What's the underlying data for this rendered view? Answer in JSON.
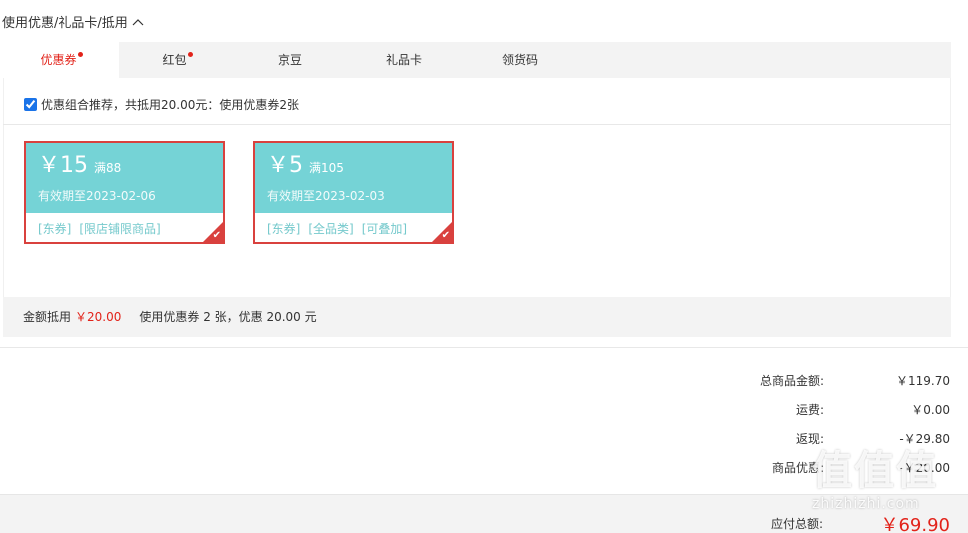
{
  "section_title": "使用优惠/礼品卡/抵用",
  "tabs": [
    {
      "label": "优惠券",
      "active": true,
      "dot": true
    },
    {
      "label": "红包",
      "active": false,
      "dot": true
    },
    {
      "label": "京豆",
      "active": false,
      "dot": false
    },
    {
      "label": "礼品卡",
      "active": false,
      "dot": false
    },
    {
      "label": "领货码",
      "active": false,
      "dot": false
    }
  ],
  "combo": {
    "checked": true,
    "text": "优惠组合推荐，共抵用20.00元：使用优惠券2张"
  },
  "coupons": [
    {
      "amount": "￥15",
      "condition": "满88",
      "valid": "有效期至2023-02-06",
      "tags": [
        "[东券]",
        "[限店铺限商品]"
      ],
      "selected": true
    },
    {
      "amount": "￥5",
      "condition": "满105",
      "valid": "有效期至2023-02-03",
      "tags": [
        "[东券]",
        "[全品类]",
        "[可叠加]"
      ],
      "selected": true
    }
  ],
  "summary": {
    "label": "金额抵用",
    "amount": "￥20.00",
    "desc": "使用优惠券 2 张，优惠 20.00 元"
  },
  "totals": [
    {
      "label": "总商品金额:",
      "value": "￥119.70"
    },
    {
      "label": "运费:",
      "value": "￥0.00"
    },
    {
      "label": "返现:",
      "value": "-￥29.80"
    },
    {
      "label": "商品优惠:",
      "value": "-￥20.00"
    }
  ],
  "pay": {
    "label": "应付总额:",
    "value": "￥69.90"
  },
  "watermark": {
    "logo": "值值值",
    "url": "zhizhizhi.com"
  },
  "colors": {
    "accent": "#e2231a",
    "coupon_bg": "#75d3d6",
    "coupon_border": "#d9413e"
  }
}
